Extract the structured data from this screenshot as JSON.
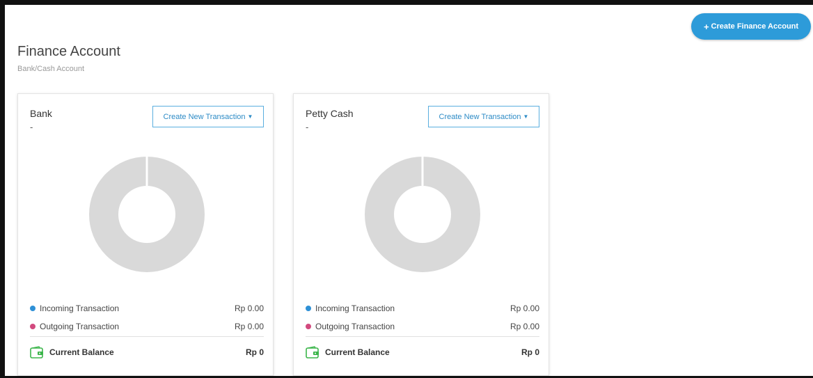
{
  "header": {
    "title": "Finance Account",
    "subtitle": "Bank/Cash Account",
    "create_button_label": "Create Finance Account"
  },
  "accounts": [
    {
      "name": "Bank",
      "sub": "-",
      "action_label": "Create New Transaction",
      "incoming_label": "Incoming Transaction",
      "incoming_value": "Rp 0.00",
      "outgoing_label": "Outgoing Transaction",
      "outgoing_value": "Rp 0.00",
      "balance_label": "Current Balance",
      "balance_value": "Rp 0"
    },
    {
      "name": "Petty Cash",
      "sub": "-",
      "action_label": "Create New Transaction",
      "incoming_label": "Incoming Transaction",
      "incoming_value": "Rp 0.00",
      "outgoing_label": "Outgoing Transaction",
      "outgoing_value": "Rp 0.00",
      "balance_label": "Current Balance",
      "balance_value": "Rp 0"
    }
  ],
  "colors": {
    "accent": "#2d9bd9",
    "incoming": "#2e90d6",
    "outgoing": "#d24a7e",
    "empty_chart": "#d9d9d9",
    "wallet": "#3bb54a"
  },
  "icons": {
    "create_button": "plus-icon",
    "dropdown": "caret-down-icon",
    "balance": "wallet-icon"
  }
}
